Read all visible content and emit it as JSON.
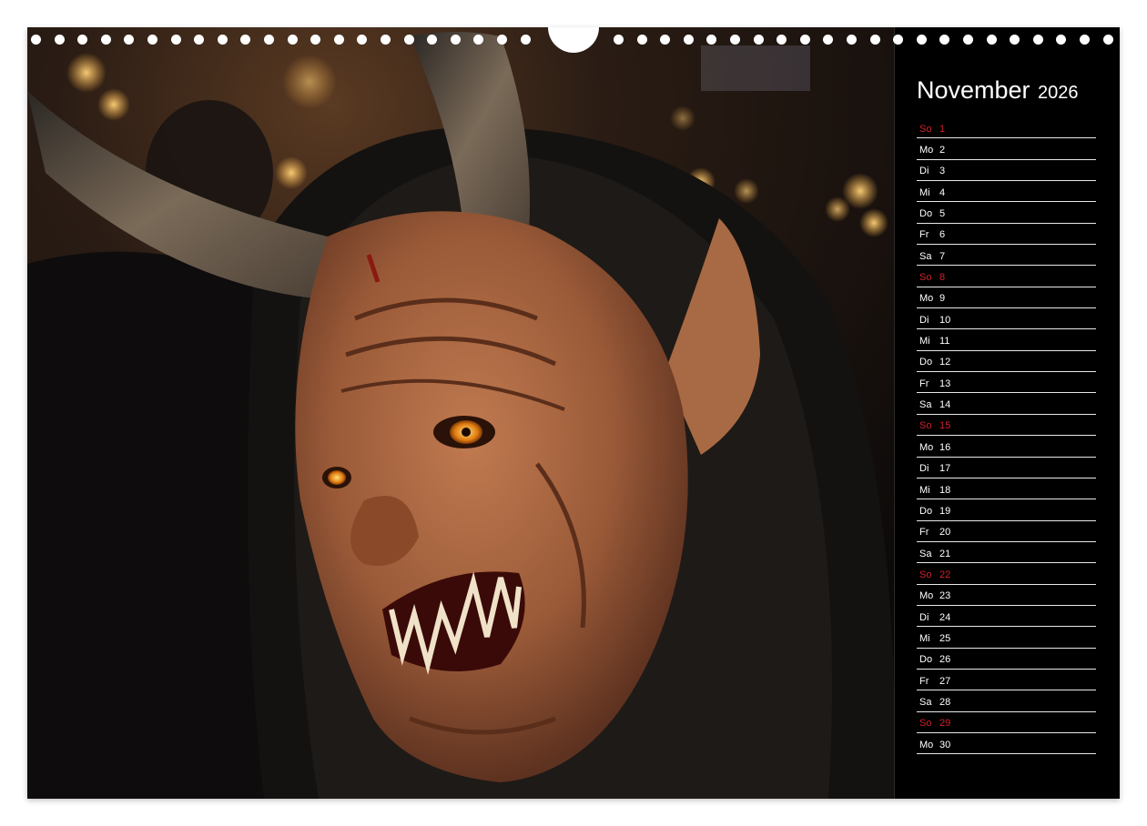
{
  "calendar": {
    "month": "November",
    "year": "2026",
    "days": [
      {
        "name": "So",
        "date": "1",
        "sunday": true
      },
      {
        "name": "Mo",
        "date": "2",
        "sunday": false
      },
      {
        "name": "Di",
        "date": "3",
        "sunday": false
      },
      {
        "name": "Mi",
        "date": "4",
        "sunday": false
      },
      {
        "name": "Do",
        "date": "5",
        "sunday": false
      },
      {
        "name": "Fr",
        "date": "6",
        "sunday": false
      },
      {
        "name": "Sa",
        "date": "7",
        "sunday": false
      },
      {
        "name": "So",
        "date": "8",
        "sunday": true
      },
      {
        "name": "Mo",
        "date": "9",
        "sunday": false
      },
      {
        "name": "Di",
        "date": "10",
        "sunday": false
      },
      {
        "name": "Mi",
        "date": "11",
        "sunday": false
      },
      {
        "name": "Do",
        "date": "12",
        "sunday": false
      },
      {
        "name": "Fr",
        "date": "13",
        "sunday": false
      },
      {
        "name": "Sa",
        "date": "14",
        "sunday": false
      },
      {
        "name": "So",
        "date": "15",
        "sunday": true
      },
      {
        "name": "Mo",
        "date": "16",
        "sunday": false
      },
      {
        "name": "Di",
        "date": "17",
        "sunday": false
      },
      {
        "name": "Mi",
        "date": "18",
        "sunday": false
      },
      {
        "name": "Do",
        "date": "19",
        "sunday": false
      },
      {
        "name": "Fr",
        "date": "20",
        "sunday": false
      },
      {
        "name": "Sa",
        "date": "21",
        "sunday": false
      },
      {
        "name": "So",
        "date": "22",
        "sunday": true
      },
      {
        "name": "Mo",
        "date": "23",
        "sunday": false
      },
      {
        "name": "Di",
        "date": "24",
        "sunday": false
      },
      {
        "name": "Mi",
        "date": "25",
        "sunday": false
      },
      {
        "name": "Do",
        "date": "26",
        "sunday": false
      },
      {
        "name": "Fr",
        "date": "27",
        "sunday": false
      },
      {
        "name": "Sa",
        "date": "28",
        "sunday": false
      },
      {
        "name": "So",
        "date": "29",
        "sunday": true
      },
      {
        "name": "Mo",
        "date": "30",
        "sunday": false
      }
    ]
  },
  "colors": {
    "panel_background": "#000000",
    "sunday": "#d0202a",
    "weekday": "#ffffff",
    "mask_wood": "#9a5a38",
    "fur": "#141210"
  },
  "photo": {
    "icon": "krampus-mask-photo"
  }
}
